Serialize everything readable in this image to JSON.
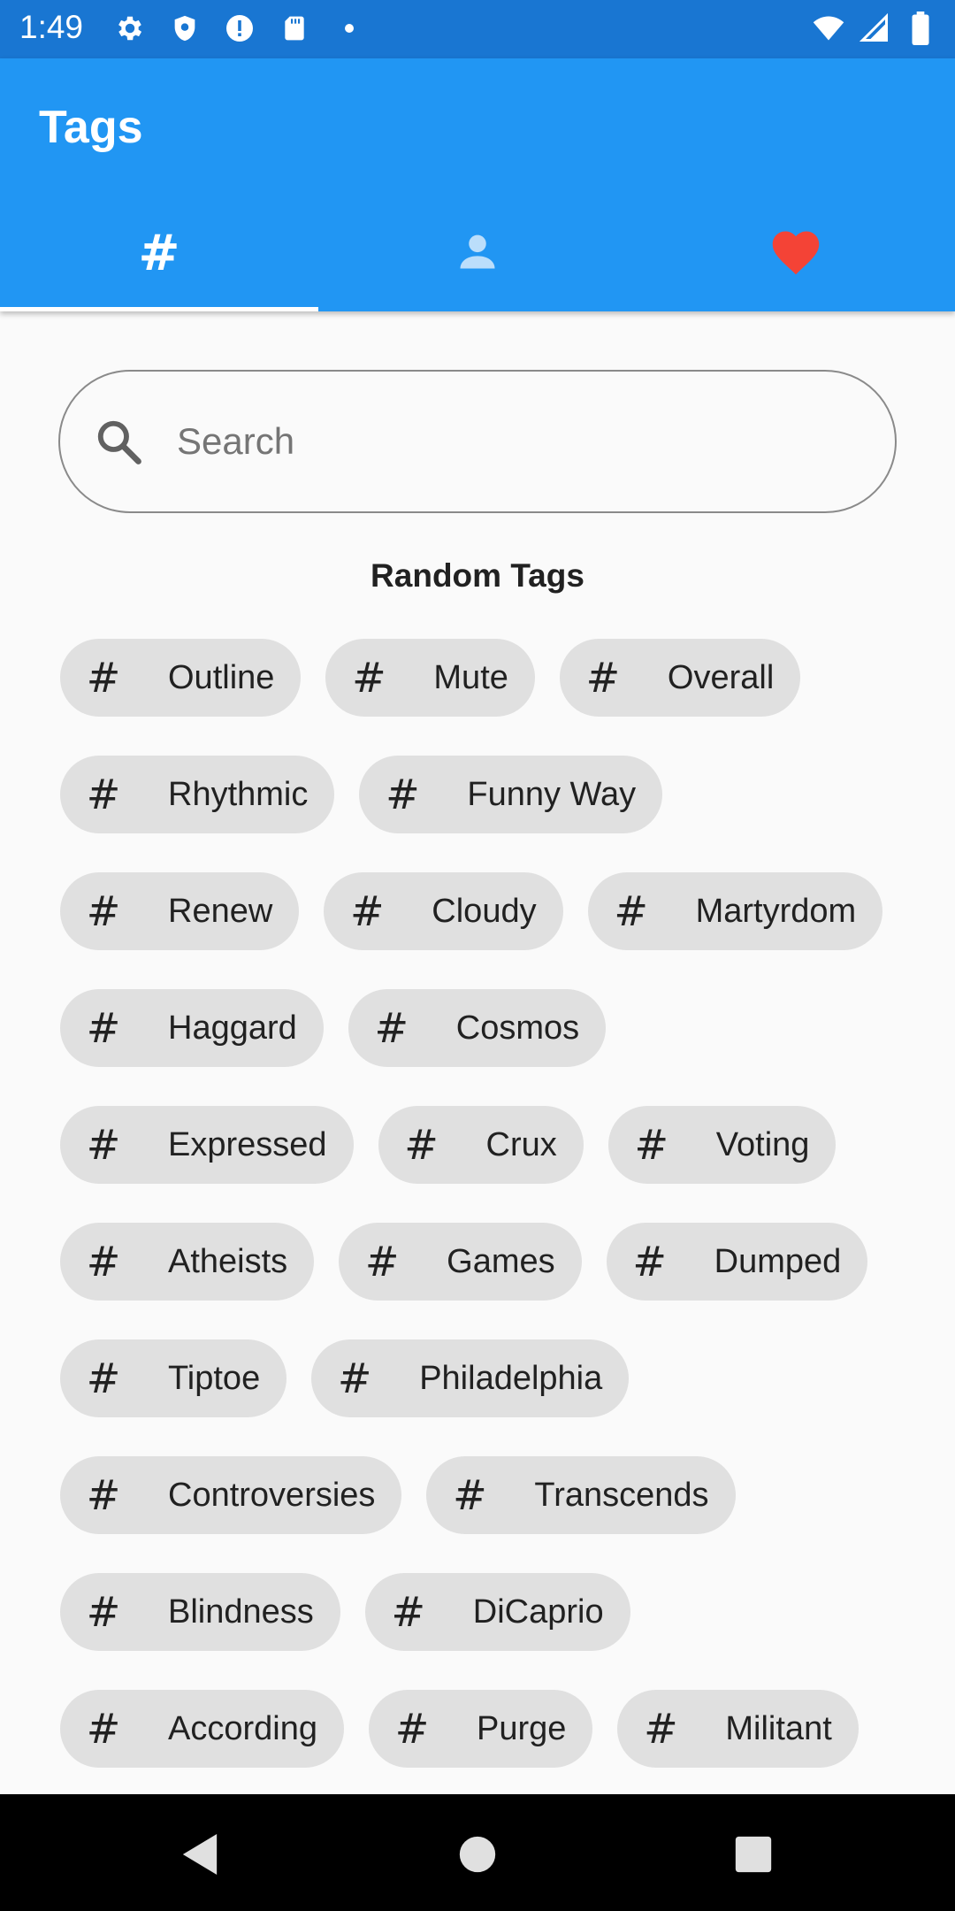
{
  "status_bar": {
    "time": "1:49",
    "icons_left": [
      "gear-icon",
      "shield-icon",
      "alert-icon",
      "sd-card-icon",
      "dot-icon"
    ],
    "icons_right": [
      "wifi-icon",
      "signal-icon",
      "battery-icon"
    ]
  },
  "app_bar": {
    "title": "Tags",
    "tabs": [
      {
        "icon": "hash-icon",
        "glyph": "#",
        "selected": true
      },
      {
        "icon": "person-icon",
        "selected": false
      },
      {
        "icon": "heart-icon",
        "selected": false
      }
    ]
  },
  "search": {
    "placeholder": "Search",
    "value": ""
  },
  "section_title": "Random Tags",
  "chip_hash_glyph": "#",
  "tags": [
    "Outline",
    "Mute",
    "Overall",
    "Rhythmic",
    "Funny Way",
    "Renew",
    "Cloudy",
    "Martyrdom",
    "Haggard",
    "Cosmos",
    "Expressed",
    "Crux",
    "Voting",
    "Atheists",
    "Games",
    "Dumped",
    "Tiptoe",
    "Philadelphia",
    "Controversies",
    "Transcends",
    "Blindness",
    "DiCaprio",
    "According",
    "Purge",
    "Militant"
  ],
  "colors": {
    "status_bar": "#1976d2",
    "app_bar": "#2196f3",
    "chip": "#e0e0e0",
    "heart": "#f44336",
    "person_icon": "#bbdefb"
  },
  "nav_bar": {
    "buttons": [
      "back-icon",
      "home-icon",
      "recents-icon"
    ]
  }
}
